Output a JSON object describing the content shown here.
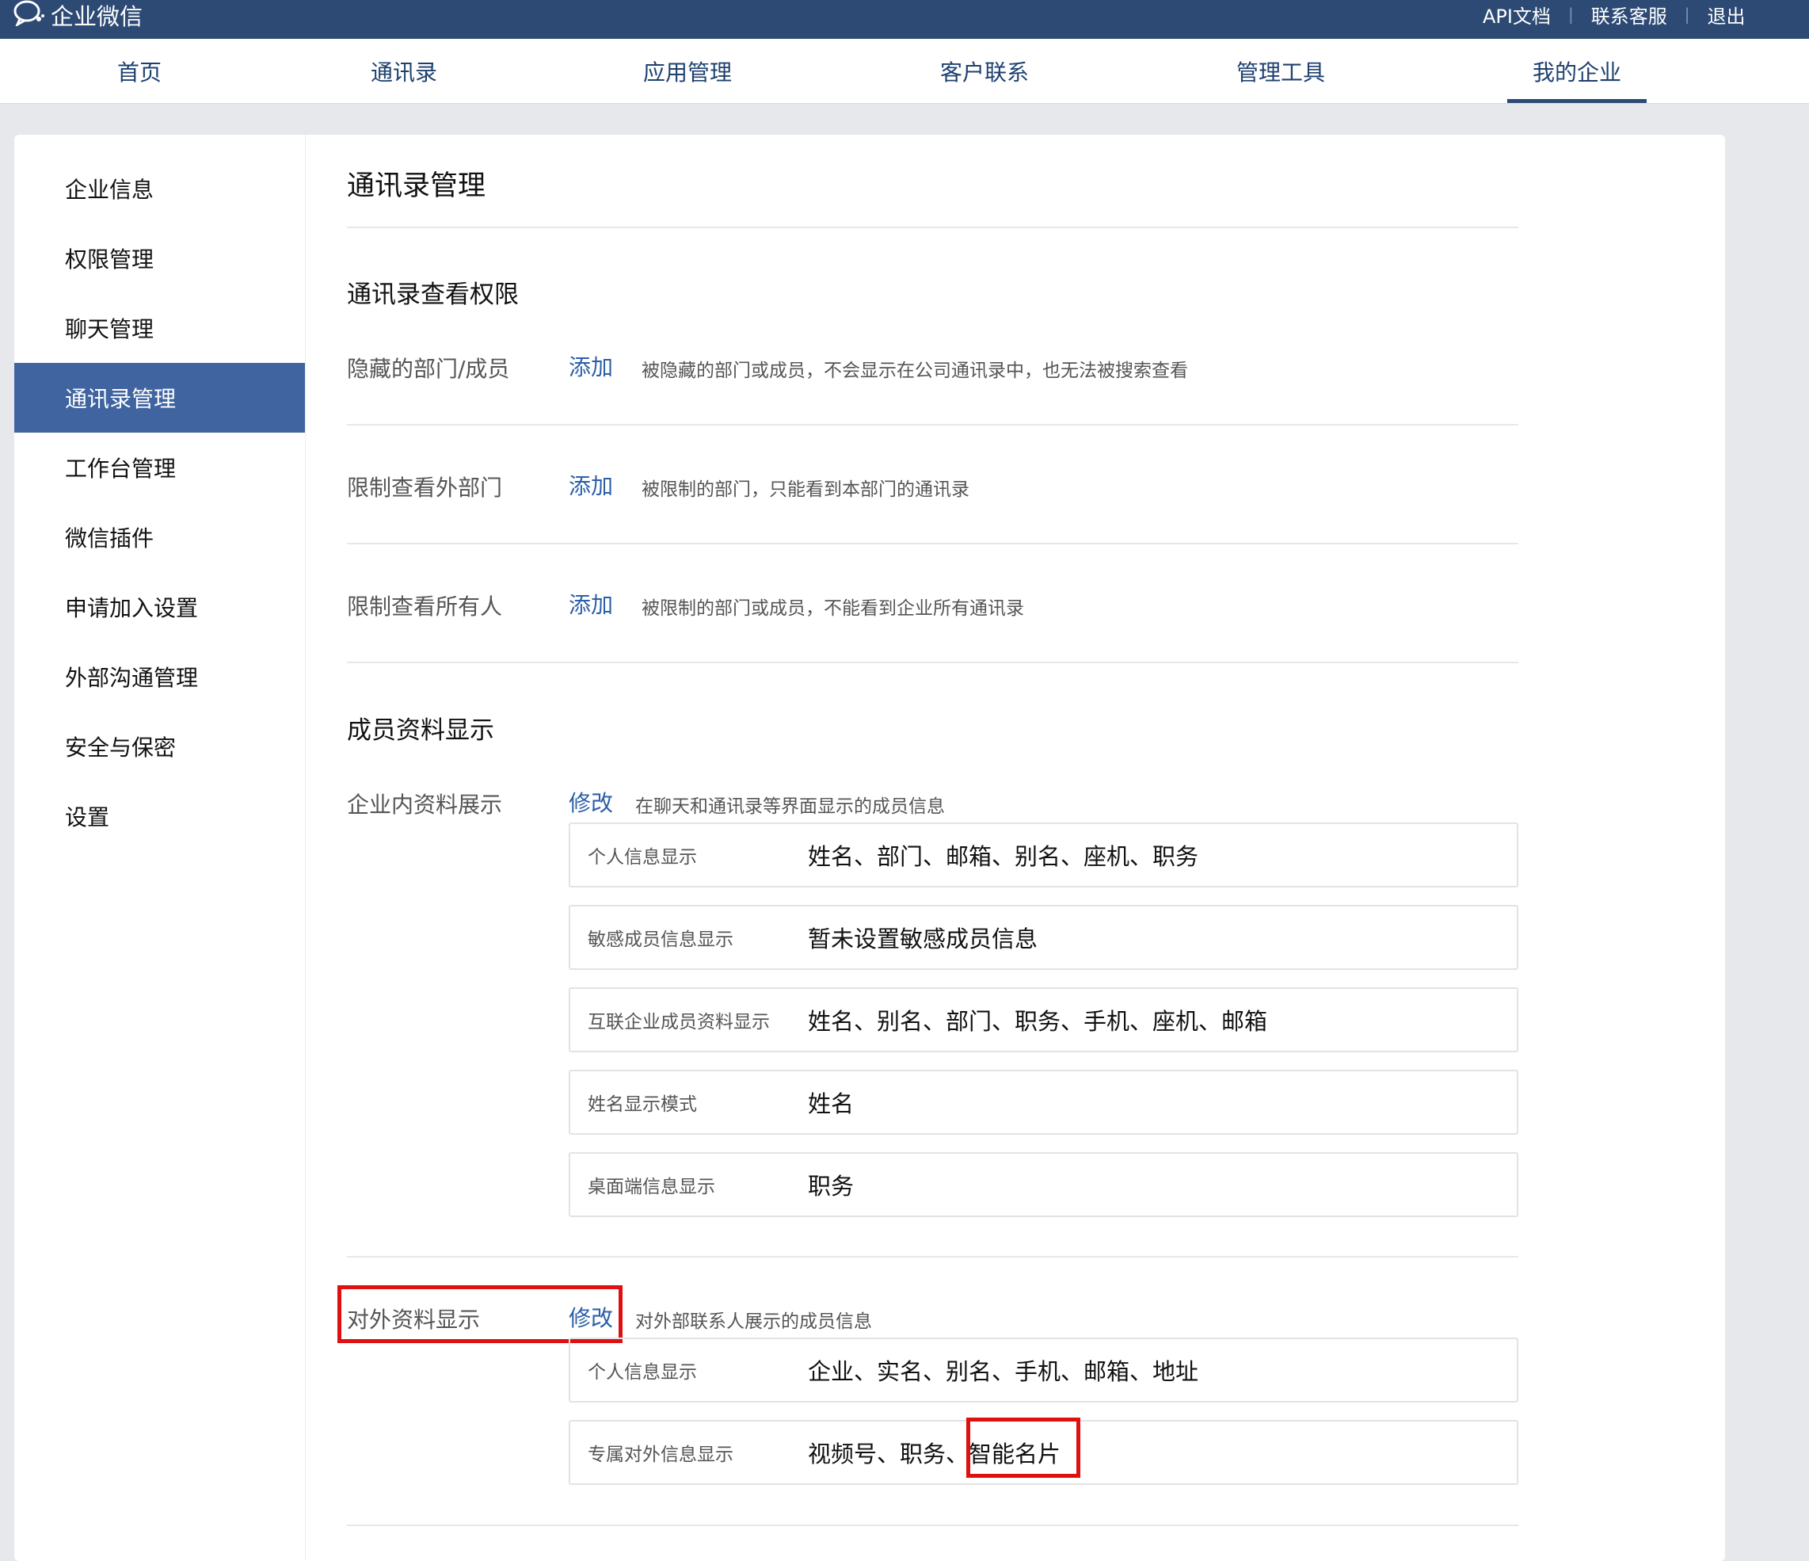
{
  "app": {
    "logo_icon": "chat-bubble-icon",
    "name": "企业微信"
  },
  "top_links": [
    "API文档",
    "联系客服",
    "退出"
  ],
  "nav": {
    "items": [
      "首页",
      "通讯录",
      "应用管理",
      "客户联系",
      "管理工具",
      "我的企业"
    ],
    "active_index": 5
  },
  "sidebar": {
    "items": [
      "企业信息",
      "权限管理",
      "聊天管理",
      "通讯录管理",
      "工作台管理",
      "微信插件",
      "申请加入设置",
      "外部沟通管理",
      "安全与保密",
      "设置"
    ],
    "active_index": 3
  },
  "main": {
    "title": "通讯录管理",
    "view_permission": {
      "title": "通讯录查看权限",
      "rows": [
        {
          "label": "隐藏的部门/成员",
          "action": "添加",
          "desc": "被隐藏的部门或成员，不会显示在公司通讯录中，也无法被搜索查看"
        },
        {
          "label": "限制查看外部门",
          "action": "添加",
          "desc": "被限制的部门，只能看到本部门的通讯录"
        },
        {
          "label": "限制查看所有人",
          "action": "添加",
          "desc": "被限制的部门或成员，不能看到企业所有通讯录"
        }
      ]
    },
    "member_display": {
      "title": "成员资料显示",
      "internal": {
        "label": "企业内资料展示",
        "action": "修改",
        "desc": "在聊天和通讯录等界面显示的成员信息",
        "rows": [
          {
            "key": "个人信息显示",
            "value": "姓名、部门、邮箱、别名、座机、职务"
          },
          {
            "key": "敏感成员信息显示",
            "value": "暂未设置敏感成员信息"
          },
          {
            "key": "互联企业成员资料显示",
            "value": "姓名、别名、部门、职务、手机、座机、邮箱"
          },
          {
            "key": "姓名显示模式",
            "value": "姓名"
          },
          {
            "key": "桌面端信息显示",
            "value": "职务"
          }
        ]
      },
      "external": {
        "label": "对外资料显示",
        "action": "修改",
        "desc": "对外部联系人展示的成员信息",
        "rows": [
          {
            "key": "个人信息显示",
            "value": "企业、实名、别名、手机、邮箱、地址"
          },
          {
            "key": "专属对外信息显示",
            "value_prefix": "视频号、职务、",
            "value_highlight": "智能名片"
          }
        ]
      }
    }
  },
  "colors": {
    "topbar": "#2d4a74",
    "sidebar_active": "#3f64a0",
    "link": "#2b5fa8",
    "highlight_box": "#e01010"
  }
}
